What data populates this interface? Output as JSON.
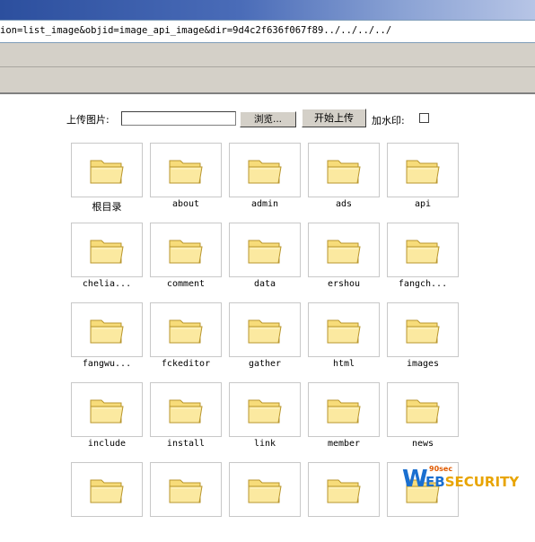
{
  "browser": {
    "url": "ion=list_image&objid=image_api_image&dir=9d4c2f636f067f89../../../../"
  },
  "upload": {
    "label": "上传图片:",
    "file_value": "",
    "browse_label": "浏览...",
    "upload_label": "开始上传",
    "watermark_label": "加水印:",
    "watermark_checked": false
  },
  "folders": [
    {
      "name": "根目录"
    },
    {
      "name": "about"
    },
    {
      "name": "admin"
    },
    {
      "name": "ads"
    },
    {
      "name": "api"
    },
    {
      "name": "chelia..."
    },
    {
      "name": "comment"
    },
    {
      "name": "data"
    },
    {
      "name": "ershou"
    },
    {
      "name": "fangch..."
    },
    {
      "name": "fangwu..."
    },
    {
      "name": "fckeditor"
    },
    {
      "name": "gather"
    },
    {
      "name": "html"
    },
    {
      "name": "images"
    },
    {
      "name": "include"
    },
    {
      "name": "install"
    },
    {
      "name": "link"
    },
    {
      "name": "member"
    },
    {
      "name": "news"
    },
    {
      "name": ""
    },
    {
      "name": ""
    },
    {
      "name": ""
    },
    {
      "name": ""
    },
    {
      "name": ""
    }
  ],
  "logo": {
    "superscript": "90sec",
    "w": "W",
    "eb": "EB",
    "security": "SECURITY"
  },
  "colors": {
    "folder_fill": "#f7dc7a",
    "folder_edge": "#b8962e",
    "logo_blue": "#1a6fd0",
    "logo_yellow": "#e8a400"
  }
}
